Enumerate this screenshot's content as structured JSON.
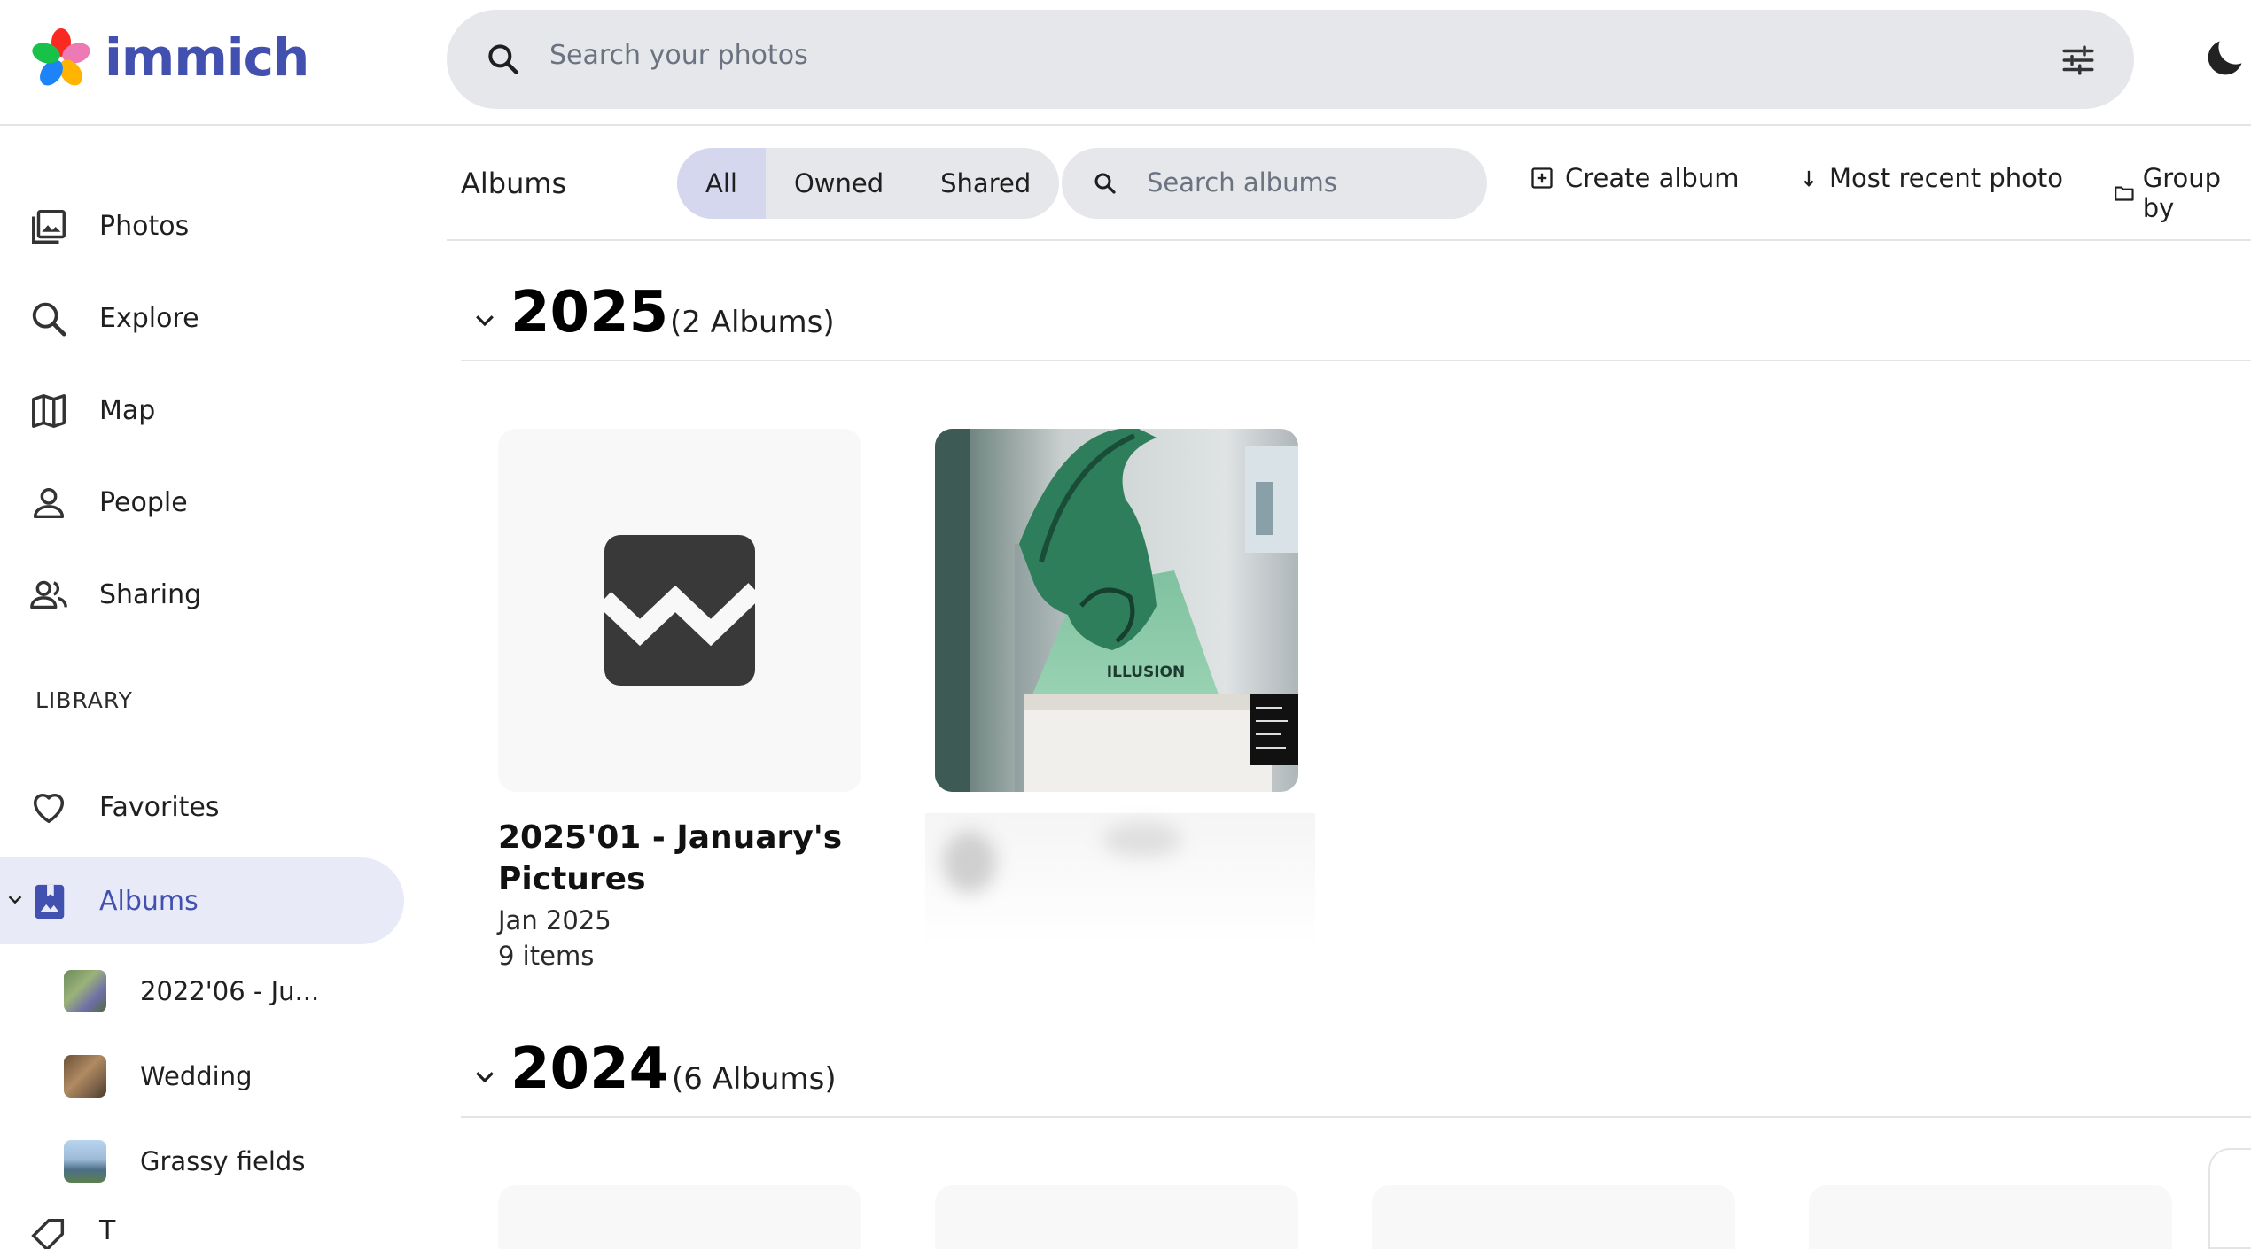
{
  "app": {
    "name": "immich",
    "accent": "#4250af"
  },
  "search": {
    "placeholder": "Search your photos"
  },
  "sidebar": {
    "items": [
      {
        "label": "Photos",
        "icon": "photos-icon"
      },
      {
        "label": "Explore",
        "icon": "search-icon"
      },
      {
        "label": "Map",
        "icon": "map-icon"
      },
      {
        "label": "People",
        "icon": "person-icon"
      },
      {
        "label": "Sharing",
        "icon": "people-icon"
      }
    ],
    "library_heading": "LIBRARY",
    "library_items": [
      {
        "label": "Favorites",
        "icon": "heart-icon"
      },
      {
        "label": "Albums",
        "icon": "album-icon",
        "active": true
      }
    ],
    "albums": [
      {
        "label": "2022'06 - Ju..."
      },
      {
        "label": "Wedding"
      },
      {
        "label": "Grassy fields"
      }
    ],
    "partial_next_label": "T"
  },
  "toolbar": {
    "title": "Albums",
    "filters": [
      "All",
      "Owned",
      "Shared"
    ],
    "active_filter": "All",
    "album_search_placeholder": "Search albums",
    "create_label": "Create album",
    "sort_label": "Most recent photo",
    "group_label": "Group by"
  },
  "groups": [
    {
      "year": "2025",
      "count_label": "(2 Albums)",
      "albums": [
        {
          "title": "2025'01 - January's Pictures",
          "date": "Jan 2025",
          "items": "9 items",
          "thumb": "placeholder"
        },
        {
          "title": "",
          "thumb": "photo",
          "thumb_text": "ILLUSION"
        }
      ]
    },
    {
      "year": "2024",
      "count_label": "(6 Albums)"
    }
  ]
}
